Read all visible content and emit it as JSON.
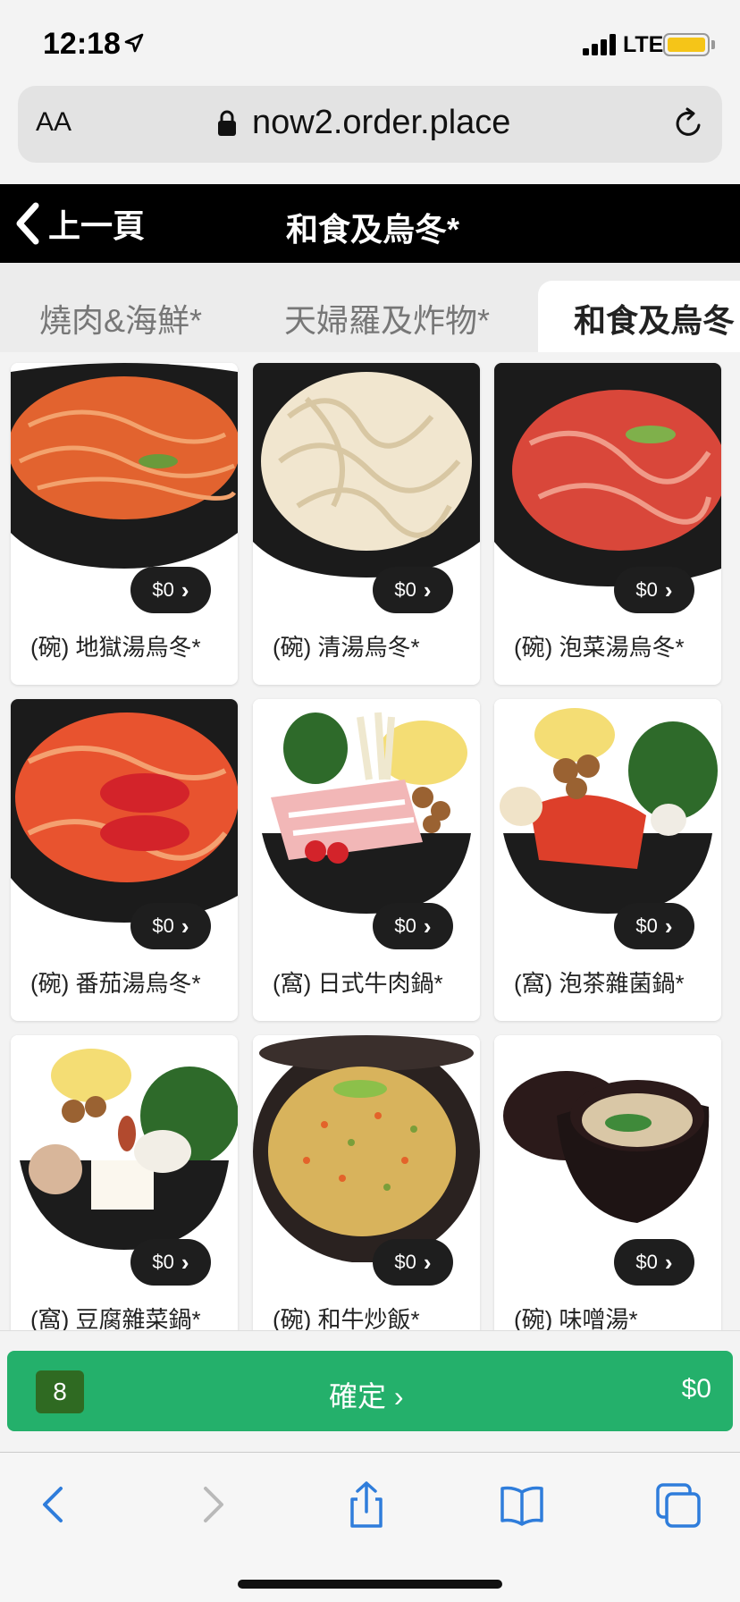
{
  "status": {
    "time": "12:18",
    "network": "LTE"
  },
  "browser": {
    "text_size_label": "AA",
    "url": "now2.order.place"
  },
  "header": {
    "back_label": "上一頁",
    "title": "和食及烏冬*"
  },
  "tabs": [
    {
      "label": "燒肉&海鮮*",
      "active": false
    },
    {
      "label": "天婦羅及炸物*",
      "active": false
    },
    {
      "label": "和食及烏冬",
      "active": true
    }
  ],
  "items": [
    {
      "name": "(碗) 地獄湯烏冬*",
      "price": "$0",
      "icon": "bowl-spicy-udon"
    },
    {
      "name": "(碗) 清湯烏冬*",
      "price": "$0",
      "icon": "bowl-clear-udon"
    },
    {
      "name": "(碗) 泡菜湯烏冬*",
      "price": "$0",
      "icon": "bowl-kimchi-udon"
    },
    {
      "name": "(碗) 番茄湯烏冬*",
      "price": "$0",
      "icon": "bowl-tomato-udon"
    },
    {
      "name": "(窩) 日式牛肉鍋*",
      "price": "$0",
      "icon": "pot-beef-hotpot"
    },
    {
      "name": "(窩) 泡茶雜菌鍋*",
      "price": "$0",
      "icon": "pot-kimchi-mushroom"
    },
    {
      "name": "(窩) 豆腐雜菜鍋*",
      "price": "$0",
      "icon": "pot-tofu-vegetable"
    },
    {
      "name": "(碗) 和牛炒飯*",
      "price": "$0",
      "icon": "plate-fried-rice"
    },
    {
      "name": "(碗) 味噌湯*",
      "price": "$0",
      "icon": "bowl-miso-soup"
    }
  ],
  "cart": {
    "count": "8",
    "confirm_label": "確定",
    "total": "$0"
  },
  "colors": {
    "confirm_green": "#24b06b",
    "badge_green": "#2f6a22",
    "header_black": "#000000",
    "safari_blue": "#2f7ddb"
  }
}
